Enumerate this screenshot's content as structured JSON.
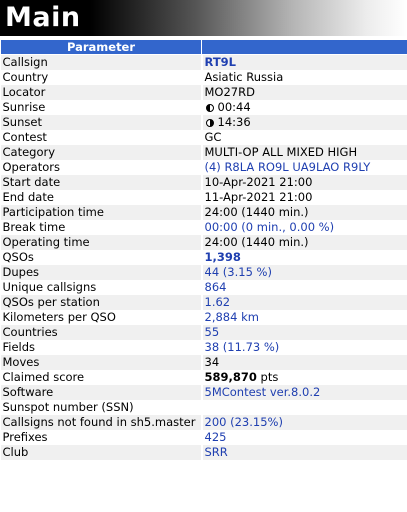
{
  "title": "Main",
  "table": {
    "header": "Parameter",
    "rows": [
      {
        "label": "Callsign",
        "value": "RT9L",
        "style": "link bold"
      },
      {
        "label": "Country",
        "value": "Asiatic Russia",
        "style": ""
      },
      {
        "label": "Locator",
        "value": "MO27RD",
        "style": ""
      },
      {
        "label": "Sunrise",
        "value": "00:44",
        "style": "",
        "icon": "sunrise-moon-icon"
      },
      {
        "label": "Sunset",
        "value": "14:36",
        "style": "",
        "icon": "sunset-moon-icon"
      },
      {
        "label": "Contest",
        "value": "GC",
        "style": ""
      },
      {
        "label": "Category",
        "value": "MULTI-OP ALL MIXED HIGH",
        "style": ""
      },
      {
        "label": "Operators",
        "value": "(4) R8LA RO9L UA9LAO R9LY",
        "style": "link"
      },
      {
        "label": "Start date",
        "value": "10-Apr-2021 21:00",
        "style": ""
      },
      {
        "label": "End date",
        "value": "11-Apr-2021 21:00",
        "style": ""
      },
      {
        "label": "Participation time",
        "value": "24:00 (1440 min.)",
        "style": ""
      },
      {
        "label": "Break time",
        "value": "00:00 (0 min., 0.00 %)",
        "style": "link"
      },
      {
        "label": "Operating time",
        "value": "24:00 (1440 min.)",
        "style": ""
      },
      {
        "label": "QSOs",
        "value": "1,398",
        "style": "link bold"
      },
      {
        "label": "Dupes",
        "value": "44 (3.15 %)",
        "style": "link"
      },
      {
        "label": "Unique callsigns",
        "value": "864",
        "style": "link"
      },
      {
        "label": "QSOs per station",
        "value": "1.62",
        "style": "link"
      },
      {
        "label": "Kilometers per QSO",
        "value": "2,884 km",
        "style": "link"
      },
      {
        "label": "Countries",
        "value": "55",
        "style": "link"
      },
      {
        "label": "Fields",
        "value": "38 (11.73 %)",
        "style": "link"
      },
      {
        "label": "Moves",
        "value": "34",
        "style": ""
      },
      {
        "label": "Claimed score",
        "value": "589,870",
        "value_suffix": " pts",
        "style": "bold"
      },
      {
        "label": "Software",
        "value": "5MContest ver.8.0.2",
        "style": "link"
      },
      {
        "label": "Sunspot number (SSN)",
        "value": "",
        "style": ""
      },
      {
        "label": "Callsigns not found in sh5.master",
        "value": "200 (23.15%)",
        "style": "link"
      },
      {
        "label": "Prefixes",
        "value": "425",
        "style": "link"
      },
      {
        "label": "Club",
        "value": "SRR",
        "style": "link"
      }
    ]
  },
  "colors": {
    "header_bg": "#3366cc",
    "link": "#1f3fb0",
    "row_alt": "#f0f0f0"
  }
}
